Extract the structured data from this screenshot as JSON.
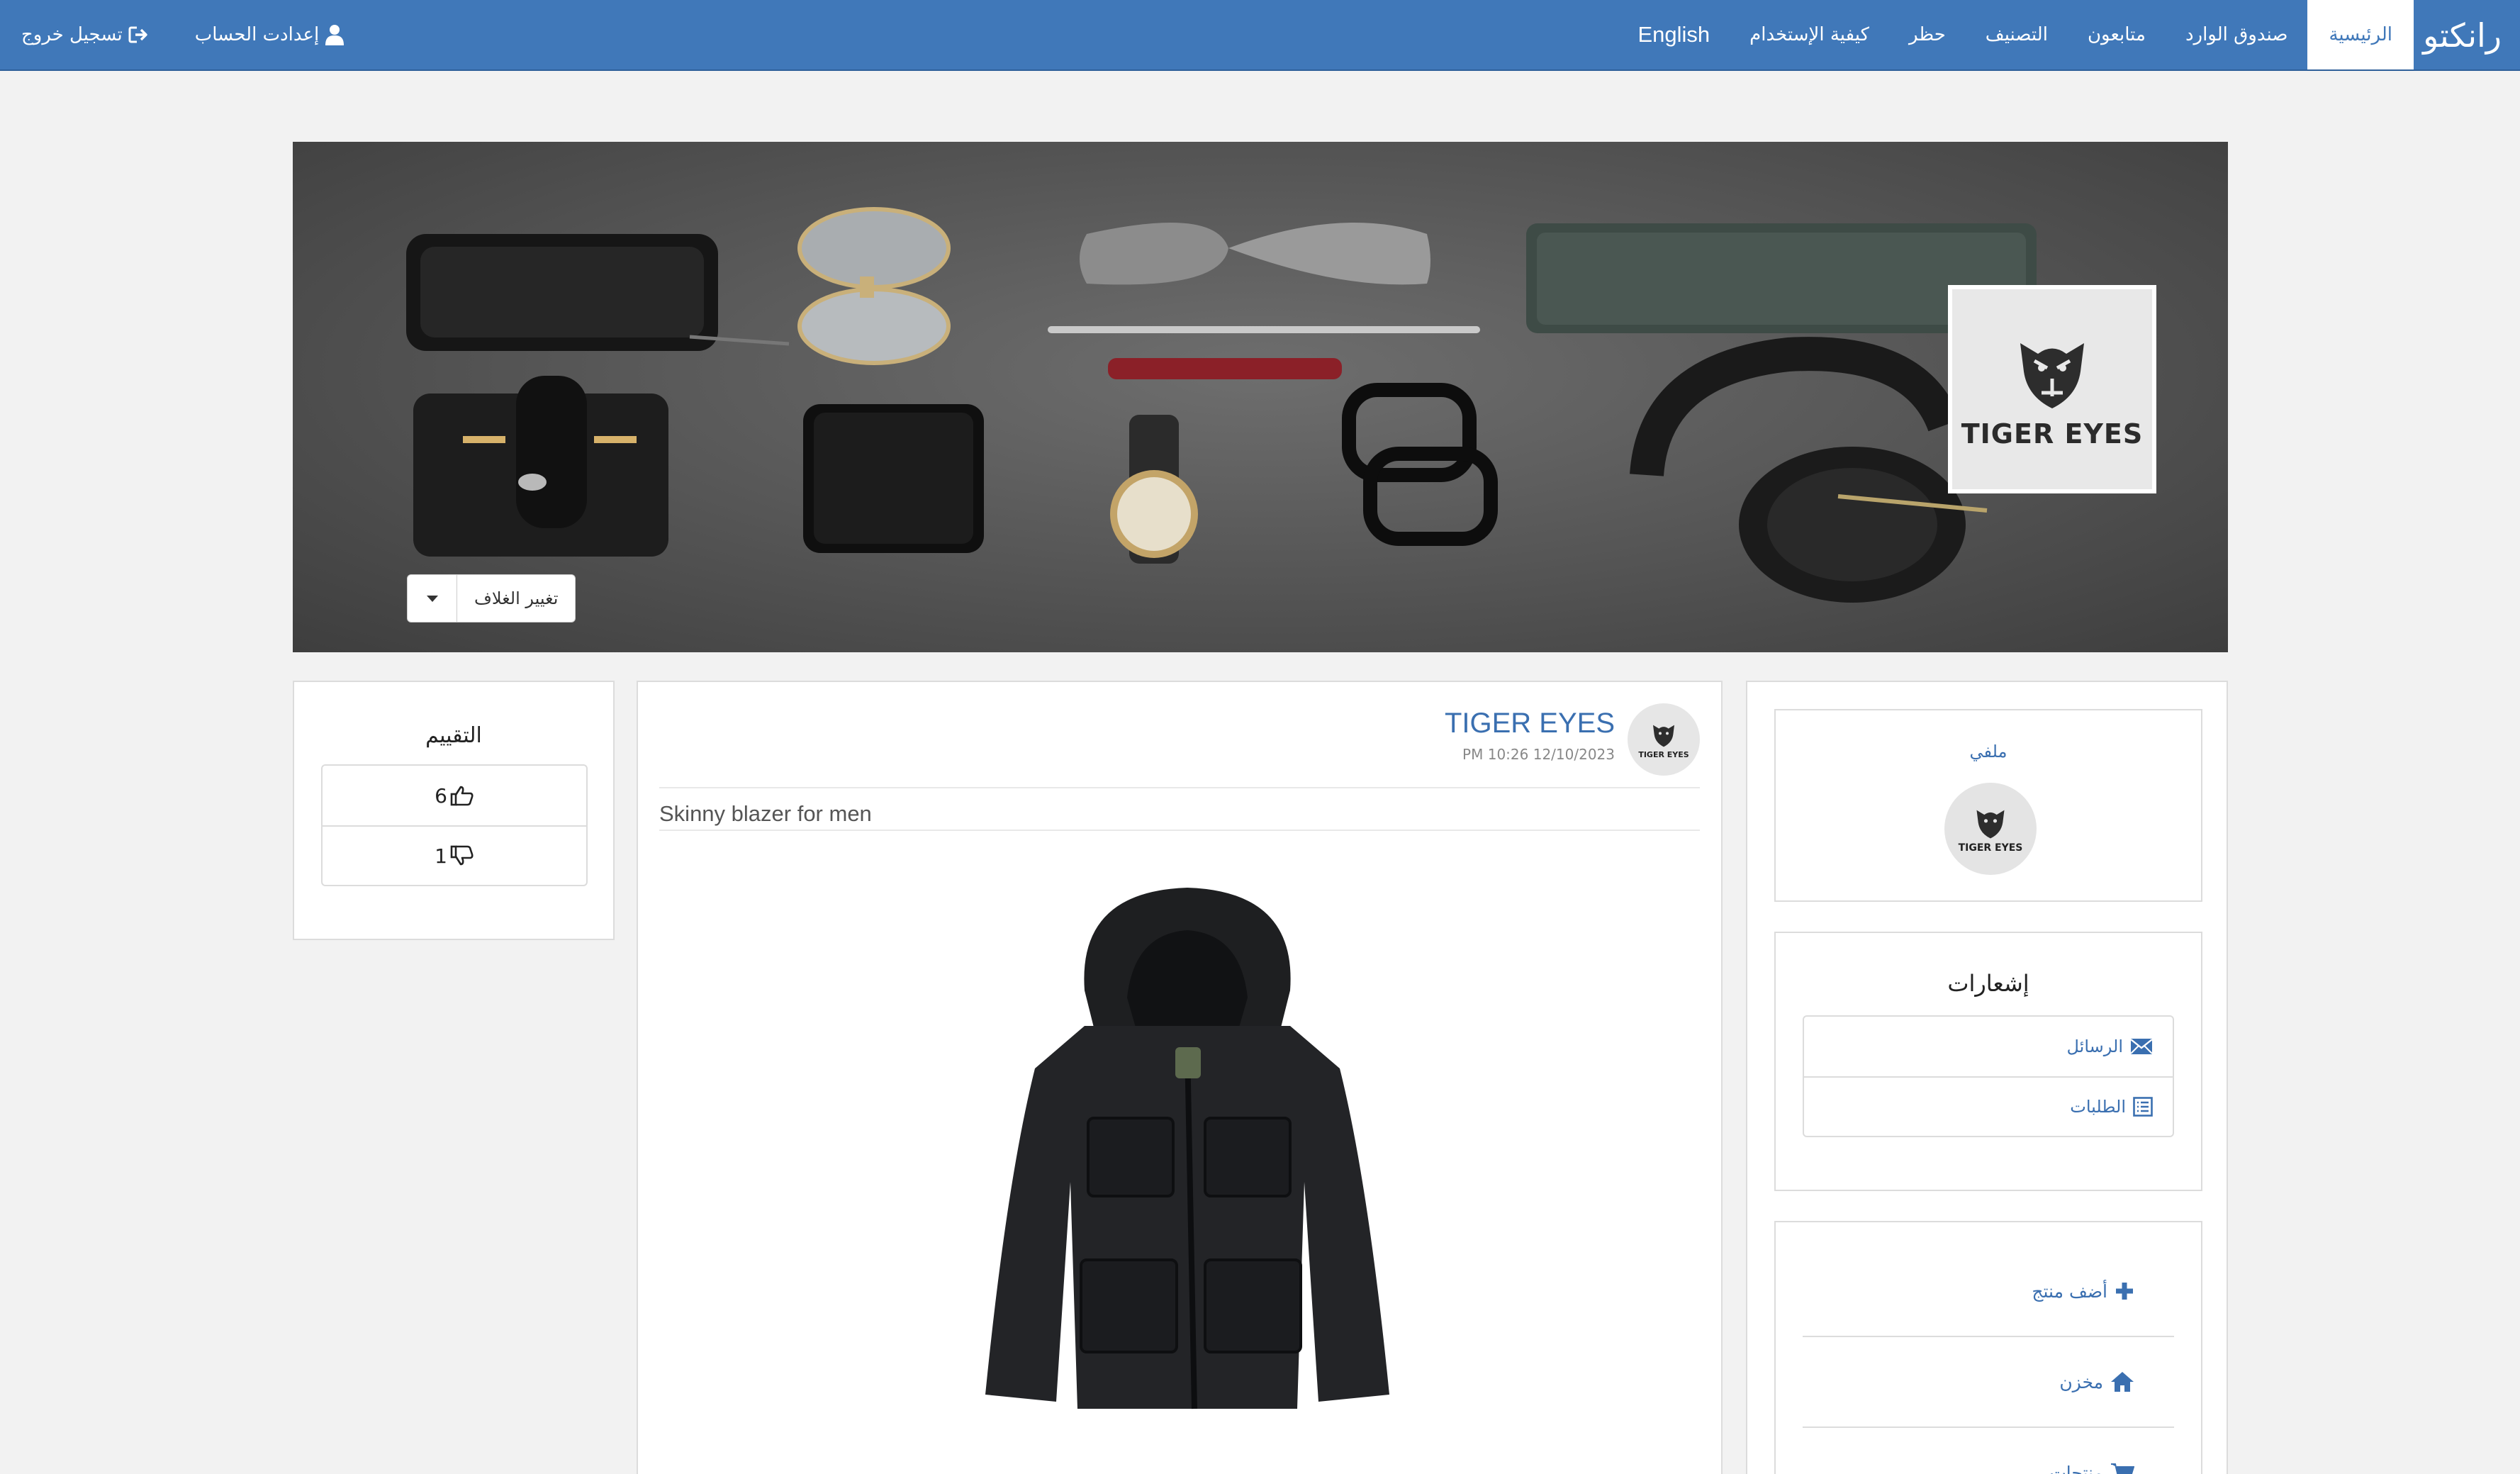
{
  "navbar": {
    "brand": "رانكتو",
    "items": [
      {
        "label": "الرئيسية",
        "active": true
      },
      {
        "label": "صندوق الوارد"
      },
      {
        "label": "متابعون"
      },
      {
        "label": "التصنيف"
      },
      {
        "label": "حظر"
      },
      {
        "label": "كيفية الإستخدام"
      },
      {
        "label": "English"
      }
    ],
    "account_settings": "إعدادت الحساب",
    "logout": "تسجيل خروج",
    "color": "#4078b9"
  },
  "cover": {
    "logo_text": "TIGER EYES",
    "change_cover_label": "تغيير الغلاف"
  },
  "rating": {
    "title": "التقييم",
    "likes": "6",
    "dislikes": "1"
  },
  "post": {
    "author": "TIGER EYES",
    "date": "PM 10:26 12/10/2023",
    "text": "Skinny blazer for men",
    "avatar_text": "TIGER EYES"
  },
  "sidebar": {
    "profile_link": "ملفي",
    "avatar_text": "TIGER EYES",
    "notifications_title": "إشعارات",
    "messages": "الرسائل",
    "orders": "الطلبات",
    "add_product": "أضف منتج",
    "store": "مخزن",
    "products": "منتجات",
    "link_color": "#3a6fb0"
  }
}
